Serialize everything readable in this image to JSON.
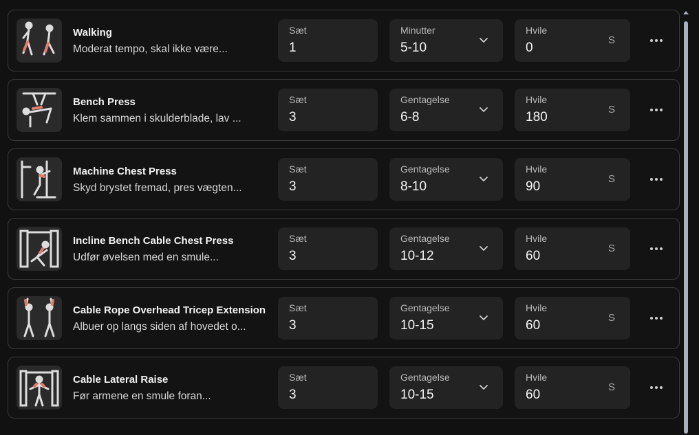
{
  "exercises": [
    {
      "title": "Walking",
      "description": "Moderat tempo, skal ikke være...",
      "sets_label": "Sæt",
      "sets": "1",
      "unit_label": "Minutter",
      "unit_value": "5-10",
      "rest_label": "Hvile",
      "rest": "0",
      "rest_suffix": "S",
      "thumb_icon": "walking-figure-icon"
    },
    {
      "title": "Bench Press",
      "description": "Klem sammen i skulderblade, lav ...",
      "sets_label": "Sæt",
      "sets": "3",
      "unit_label": "Gentagelse",
      "unit_value": "6-8",
      "rest_label": "Hvile",
      "rest": "180",
      "rest_suffix": "S",
      "thumb_icon": "bench-press-figure-icon"
    },
    {
      "title": "Machine Chest Press",
      "description": "Skyd brystet fremad, pres vægten...",
      "sets_label": "Sæt",
      "sets": "3",
      "unit_label": "Gentagelse",
      "unit_value": "8-10",
      "rest_label": "Hvile",
      "rest": "90",
      "rest_suffix": "S",
      "thumb_icon": "chest-press-machine-icon"
    },
    {
      "title": "Incline Bench Cable Chest Press",
      "description": "Udfør øvelsen med en smule...",
      "sets_label": "Sæt",
      "sets": "3",
      "unit_label": "Gentagelse",
      "unit_value": "10-12",
      "rest_label": "Hvile",
      "rest": "60",
      "rest_suffix": "S",
      "thumb_icon": "cable-incline-press-icon"
    },
    {
      "title": "Cable Rope Overhead Tricep Extension",
      "description": "Albuer op langs siden af hovedet o...",
      "sets_label": "Sæt",
      "sets": "3",
      "unit_label": "Gentagelse",
      "unit_value": "10-15",
      "rest_label": "Hvile",
      "rest": "60",
      "rest_suffix": "S",
      "thumb_icon": "overhead-tricep-figure-icon"
    },
    {
      "title": "Cable Lateral Raise",
      "description": "Før armene en smule foran...",
      "sets_label": "Sæt",
      "sets": "3",
      "unit_label": "Gentagelse",
      "unit_value": "10-15",
      "rest_label": "Hvile",
      "rest": "60",
      "rest_suffix": "S",
      "thumb_icon": "cable-lateral-raise-icon"
    }
  ],
  "colors": {
    "background": "#111111",
    "card_border": "#3a3a3a",
    "field_bg": "#232323",
    "muscle_highlight": "#e07a6a",
    "scrollbar": "#a9b0bf"
  }
}
